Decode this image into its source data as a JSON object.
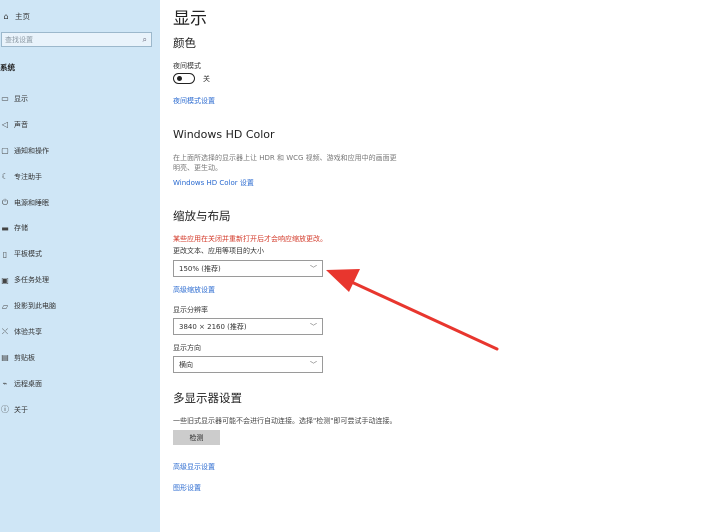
{
  "sidebar": {
    "home": "主页",
    "search_placeholder": "查找设置",
    "section": "系统",
    "items": [
      {
        "label": "显示",
        "icon": "monitor-icon"
      },
      {
        "label": "声音",
        "icon": "speaker-icon"
      },
      {
        "label": "通知和操作",
        "icon": "notification-icon"
      },
      {
        "label": "专注助手",
        "icon": "moon-icon"
      },
      {
        "label": "电源和睡眠",
        "icon": "power-icon"
      },
      {
        "label": "存储",
        "icon": "storage-icon"
      },
      {
        "label": "平板模式",
        "icon": "tablet-icon"
      },
      {
        "label": "多任务处理",
        "icon": "multitask-icon"
      },
      {
        "label": "投影到此电脑",
        "icon": "project-icon"
      },
      {
        "label": "体验共享",
        "icon": "share-icon"
      },
      {
        "label": "剪贴板",
        "icon": "clipboard-icon"
      },
      {
        "label": "远程桌面",
        "icon": "remote-desktop-icon"
      },
      {
        "label": "关于",
        "icon": "info-icon"
      }
    ]
  },
  "main": {
    "title": "显示",
    "color": {
      "heading": "颜色",
      "night_light_label": "夜间模式",
      "toggle_state": "关",
      "night_light_link": "夜间模式设置"
    },
    "hdr": {
      "heading": "Windows HD Color",
      "desc_line1": "在上面所选择的显示器上让 HDR 和 WCG 视频、游戏和应用中的画面更",
      "desc_line2": "明亮、更生动。",
      "link": "Windows HD Color 设置"
    },
    "scale": {
      "heading": "缩放与布局",
      "warning": "某些应用在关闭并重新打开后才会响应缩放更改。",
      "size_label": "更改文本、应用等项目的大小",
      "size_value": "150% (推荐)",
      "advanced_link": "高级缩放设置",
      "resolution_label": "显示分辨率",
      "resolution_value": "3840 × 2160 (推荐)",
      "orientation_label": "显示方向",
      "orientation_value": "横向"
    },
    "multi": {
      "heading": "多显示器设置",
      "desc": "一些旧式显示器可能不会进行自动连接。选择\"检测\"即可尝试手动连接。",
      "detect_button": "检测",
      "advanced_display_link": "高级显示设置",
      "graphics_link": "图形设置"
    }
  },
  "colors": {
    "sidebar_bg": "#cfe6f6",
    "link": "#2a6ad0",
    "warning": "#d33a2a",
    "arrow": "#e8362e"
  }
}
